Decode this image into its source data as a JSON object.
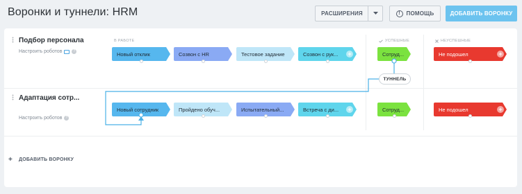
{
  "header": {
    "title": "Воронки и туннели: HRM",
    "extensions_label": "РАСШИРЕНИЯ",
    "help_label": "ПОМОЩЬ",
    "add_funnel_label": "ДОБАВИТЬ ВОРОНКУ"
  },
  "sections": {
    "in_work": "В РАБОТЕ",
    "success": "УСПЕШНЫЕ",
    "failure": "НЕУСПЕШНЫЕ"
  },
  "funnels": [
    {
      "name": "Подбор персонала",
      "robots_label": "Настроить роботов",
      "stages": [
        "Новый отклик",
        "Созвон с HR",
        "Тестовое задание",
        "Созвон с рук..."
      ],
      "success_stage": "Сотруд...",
      "fail_stage": "Не подошел"
    },
    {
      "name": "Адаптация сотр...",
      "robots_label": "Настроить роботов",
      "stages": [
        "Новый сотрудник",
        "Пройдено обуч...",
        "Испытательный...",
        "Встреча с ди..."
      ],
      "success_stage": "Сотруд...",
      "fail_stage": "Не подошел"
    }
  ],
  "tunnel_label": "ТУННЕЛЬ",
  "footer": {
    "add_funnel_label": "ДОБАВИТЬ ВОРОНКУ"
  },
  "colors": {
    "stage1": "#56b7ee",
    "stage2": "#8aaaf4",
    "stage3": "#bfe6f8",
    "stage4": "#5fd5ec",
    "success": "#7be23f",
    "fail": "#e8392f",
    "tunnel_line": "#4ab0e6",
    "add_button": "#6cc3ef"
  }
}
